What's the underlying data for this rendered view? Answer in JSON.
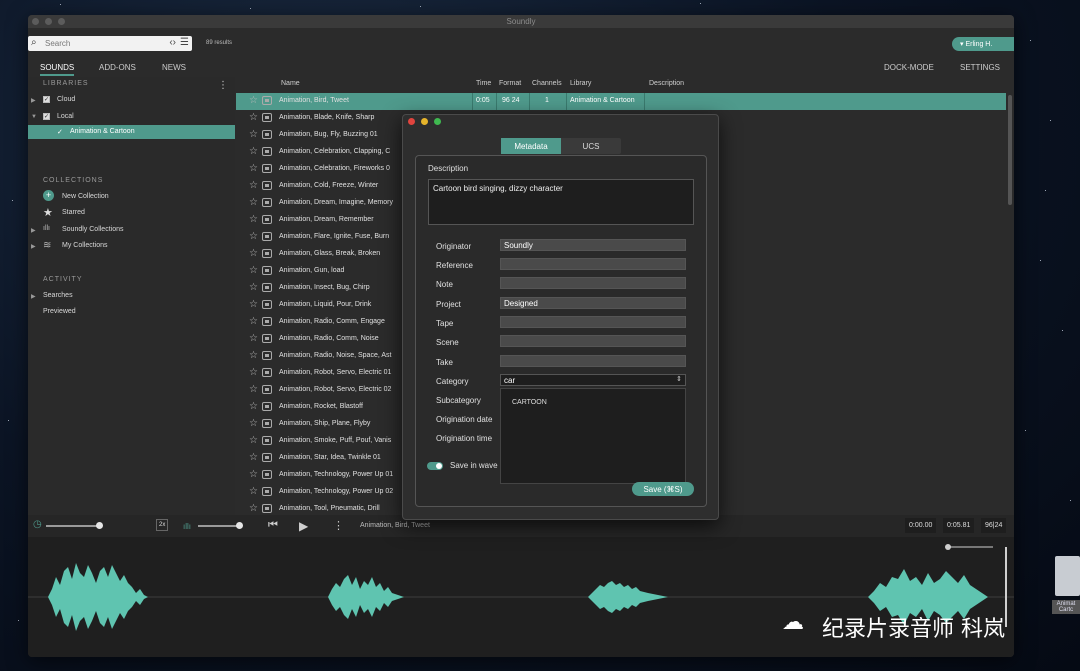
{
  "window": {
    "title": "Soundly"
  },
  "search": {
    "placeholder": "Search",
    "results": "89 results"
  },
  "user": {
    "name": "Erling H."
  },
  "tabs": {
    "sounds": "SOUNDS",
    "addons": "ADD-ONS",
    "news": "NEWS",
    "dock": "DOCK-MODE",
    "settings": "SETTINGS"
  },
  "sidebar": {
    "libraries_title": "LIBRARIES",
    "cloud": "Cloud",
    "local": "Local",
    "local_child": "Animation & Cartoon",
    "collections_title": "COLLECTIONS",
    "new_collection": "New Collection",
    "starred": "Starred",
    "soundly_collections": "Soundly Collections",
    "my_collections": "My Collections",
    "activity_title": "ACTIVITY",
    "searches": "Searches",
    "previewed": "Previewed"
  },
  "columns": {
    "name": "Name",
    "time": "Time",
    "format": "Format",
    "channels": "Channels",
    "library": "Library",
    "description": "Description"
  },
  "selected_row": {
    "time": "0:05",
    "format": "96 24",
    "channels": "1",
    "library": "Animation & Cartoon"
  },
  "rows": [
    "Animation, Bird, Tweet",
    "Animation, Blade, Knife, Sharp",
    "Animation, Bug, Fly, Buzzing 01",
    "Animation, Celebration, Clapping, C",
    "Animation, Celebration, Fireworks 0",
    "Animation, Cold, Freeze, Winter",
    "Animation, Dream, Imagine, Memory",
    "Animation, Dream, Remember",
    "Animation, Flare, Ignite, Fuse, Burn",
    "Animation, Glass, Break, Broken",
    "Animation, Gun, load",
    "Animation, Insect, Bug, Chirp",
    "Animation, Liquid, Pour, Drink",
    "Animation, Radio, Comm, Engage",
    "Animation, Radio, Comm, Noise",
    "Animation, Radio, Noise, Space, Ast",
    "Animation, Robot, Servo, Electric 01",
    "Animation, Robot, Servo, Electric 02",
    "Animation, Rocket, Blastoff",
    "Animation, Ship, Plane, Flyby",
    "Animation, Smoke, Puff, Pouf, Vanis",
    "Animation, Star, Idea, Twinkle 01",
    "Animation, Technology, Power Up 01",
    "Animation, Technology, Power Up 02",
    "Animation, Tool, Pneumatic, Drill"
  ],
  "transport": {
    "speed": "2x",
    "now_playing": "Animation, Bird, Tweet",
    "position": "0:00.00",
    "duration": "0:05.81",
    "format": "96|24"
  },
  "dialog": {
    "tab_metadata": "Metadata",
    "tab_ucs": "UCS",
    "description_label": "Description",
    "description_value": "Cartoon bird singing, dizzy character",
    "fields": [
      {
        "label": "Originator",
        "value": "Soundly"
      },
      {
        "label": "Reference",
        "value": ""
      },
      {
        "label": "Note",
        "value": ""
      },
      {
        "label": "Project",
        "value": "Designed"
      },
      {
        "label": "Tape",
        "value": ""
      },
      {
        "label": "Scene",
        "value": ""
      },
      {
        "label": "Take",
        "value": ""
      },
      {
        "label": "Category",
        "value": "car"
      },
      {
        "label": "Subcategory",
        "value": ""
      },
      {
        "label": "Origination date",
        "value": ""
      },
      {
        "label": "Origination time",
        "value": ""
      }
    ],
    "dropdown_option": "CARTOON",
    "save_in_wave": "Save in wave",
    "save_button": "Save (⌘S)"
  },
  "desktop": {
    "icon_label": "Animat\nCartc"
  },
  "watermark": {
    "text": "纪录片录音师 科岚"
  },
  "colors": {
    "accent": "#4f9a8c",
    "wave": "#5fc4b0"
  }
}
